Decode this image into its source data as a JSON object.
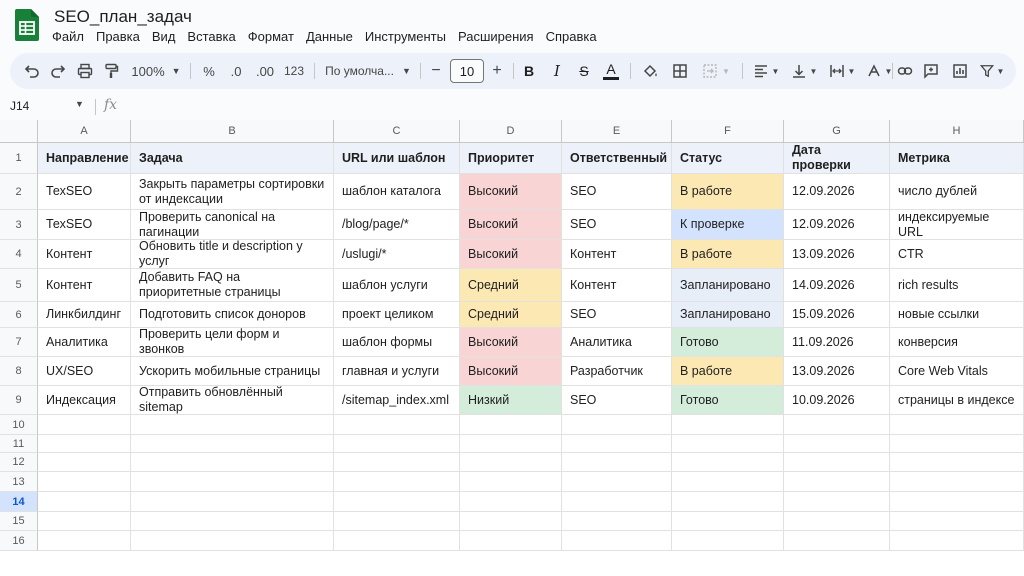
{
  "app": {
    "title": "SEO_план_задач",
    "menu": [
      "Файл",
      "Правка",
      "Вид",
      "Вставка",
      "Формат",
      "Данные",
      "Инструменты",
      "Расширения",
      "Справка"
    ]
  },
  "toolbar": {
    "zoom": "100%",
    "percent": "%",
    "decrease_decimal": ".0",
    "increase_decimal": ".00",
    "number_format": "123",
    "font": "По умолча...",
    "font_size_minus": "−",
    "font_size": "10",
    "font_size_plus": "+",
    "bold": "B",
    "italic": "I",
    "strike": "S",
    "text_color": "A"
  },
  "formula_bar": {
    "cell_ref": "J14",
    "fx": "fx",
    "formula": ""
  },
  "grid": {
    "columns": [
      "A",
      "B",
      "C",
      "D",
      "E",
      "F",
      "G",
      "H"
    ],
    "row_numbers": [
      "1",
      "2",
      "3",
      "4",
      "5",
      "6",
      "7",
      "8",
      "9",
      "10",
      "11",
      "12",
      "13",
      "14",
      "15",
      "16"
    ],
    "active_row": "14",
    "headers": [
      "Направление",
      "Задача",
      "URL или шаблон",
      "Приоритет",
      "Ответственный",
      "Статус",
      "Дата проверки",
      "Метрика"
    ],
    "rows": [
      [
        "ТехSEO",
        "Закрыть параметры сортировки от индексации",
        "шаблон каталога",
        "Высокий",
        "SEO",
        "В работе",
        "12.09.2026",
        "число дублей"
      ],
      [
        "ТехSEO",
        "Проверить canonical на пагинации",
        "/blog/page/*",
        "Высокий",
        "SEO",
        "К проверке",
        "12.09.2026",
        "индексируемые URL"
      ],
      [
        "Контент",
        "Обновить title и description у услуг",
        "/uslugi/*",
        "Высокий",
        "Контент",
        "В работе",
        "13.09.2026",
        "CTR"
      ],
      [
        "Контент",
        "Добавить FAQ на приоритетные страницы",
        "шаблон услуги",
        "Средний",
        "Контент",
        "Запланировано",
        "14.09.2026",
        "rich results"
      ],
      [
        "Линкбилдинг",
        "Подготовить список доноров",
        "проект целиком",
        "Средний",
        "SEO",
        "Запланировано",
        "15.09.2026",
        "новые ссылки"
      ],
      [
        "Аналитика",
        "Проверить цели форм и звонков",
        "шаблон формы",
        "Высокий",
        "Аналитика",
        "Готово",
        "11.09.2026",
        "конверсия"
      ],
      [
        "UX/SEO",
        "Ускорить мобильные страницы",
        "главная и услуги",
        "Высокий",
        "Разработчик",
        "В работе",
        "13.09.2026",
        "Core Web Vitals"
      ],
      [
        "Индексация",
        "Отправить обновлённый sitemap",
        "/sitemap_index.xml",
        "Низкий",
        "SEO",
        "Готово",
        "10.09.2026",
        "страницы в индексе"
      ]
    ],
    "colors": {
      "priority": {
        "Высокий": "#f8d4d4",
        "Средний": "#fce8b2",
        "Низкий": "#d4edda"
      },
      "status": {
        "В работе": "#fce8b2",
        "К проверке": "#d3e3fd",
        "Запланировано": "#e8eef8",
        "Готово": "#d4edda"
      },
      "header": "#edf2fa",
      "active_row_header": "#d3e3fd",
      "brand": "#188038"
    }
  }
}
